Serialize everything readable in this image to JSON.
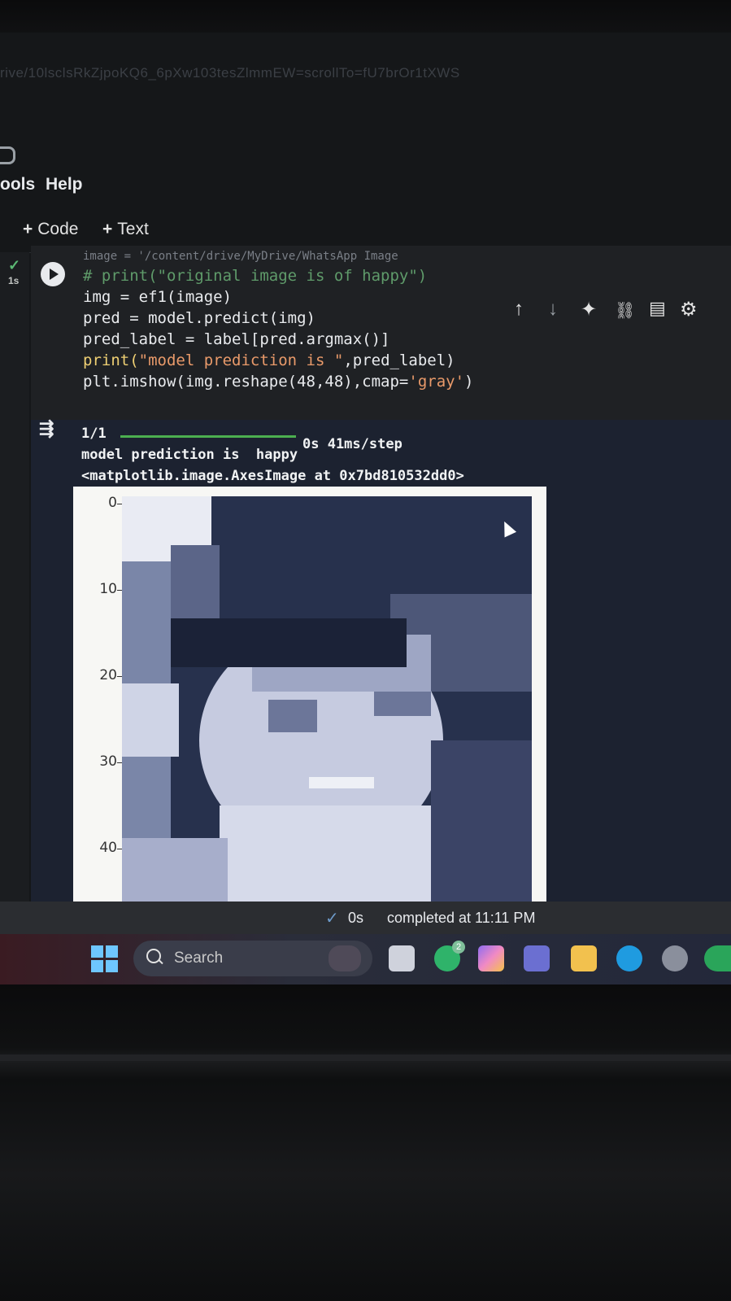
{
  "browser": {
    "url_fragment": "rive/10lsclsRkZjpoKQ6_6pXw103tesZlmmEW=scrollTo=fU7brOr1tXWS"
  },
  "menubar": {
    "items": [
      "ools",
      "Help"
    ]
  },
  "toolbar": {
    "add_code_label": "Code",
    "add_text_label": "Text"
  },
  "cell": {
    "exec_time": "1s",
    "code_lines": {
      "partial": "image = '/content/drive/MyDrive/WhatsApp Image",
      "comment": "# print(\"original image is of happy\")",
      "line1": "img = ef1(image)",
      "line2": "pred = model.predict(img)",
      "line3": "pred_label = label[pred.argmax()]",
      "line4_pre": "print(",
      "line4_str": "\"model prediction is \"",
      "line4_post": ",pred_label)",
      "line5_pre": "plt.imshow(img.reshape(48,48),cmap=",
      "line5_str": "'gray'",
      "line5_post": ")"
    },
    "tools": [
      "arrow-up-icon",
      "arrow-down-icon",
      "sparkle-icon",
      "link-icon",
      "comment-icon",
      "gear-icon"
    ]
  },
  "output": {
    "progress_label": "1/1",
    "progress_fraction": 1.0,
    "step_text": "0s 41ms/step",
    "prediction_line": "model prediction is  happy",
    "repr_line": "<matplotlib.image.AxesImage at 0x7bd810532dd0>",
    "y_ticks": [
      "0",
      "10",
      "20",
      "30",
      "40"
    ]
  },
  "statusbar": {
    "duration": "0s",
    "completed": "completed at 11:11 PM"
  },
  "taskbar": {
    "search_label": "Search",
    "whatsapp_badge": "2",
    "accent": "#6ec6ff"
  }
}
